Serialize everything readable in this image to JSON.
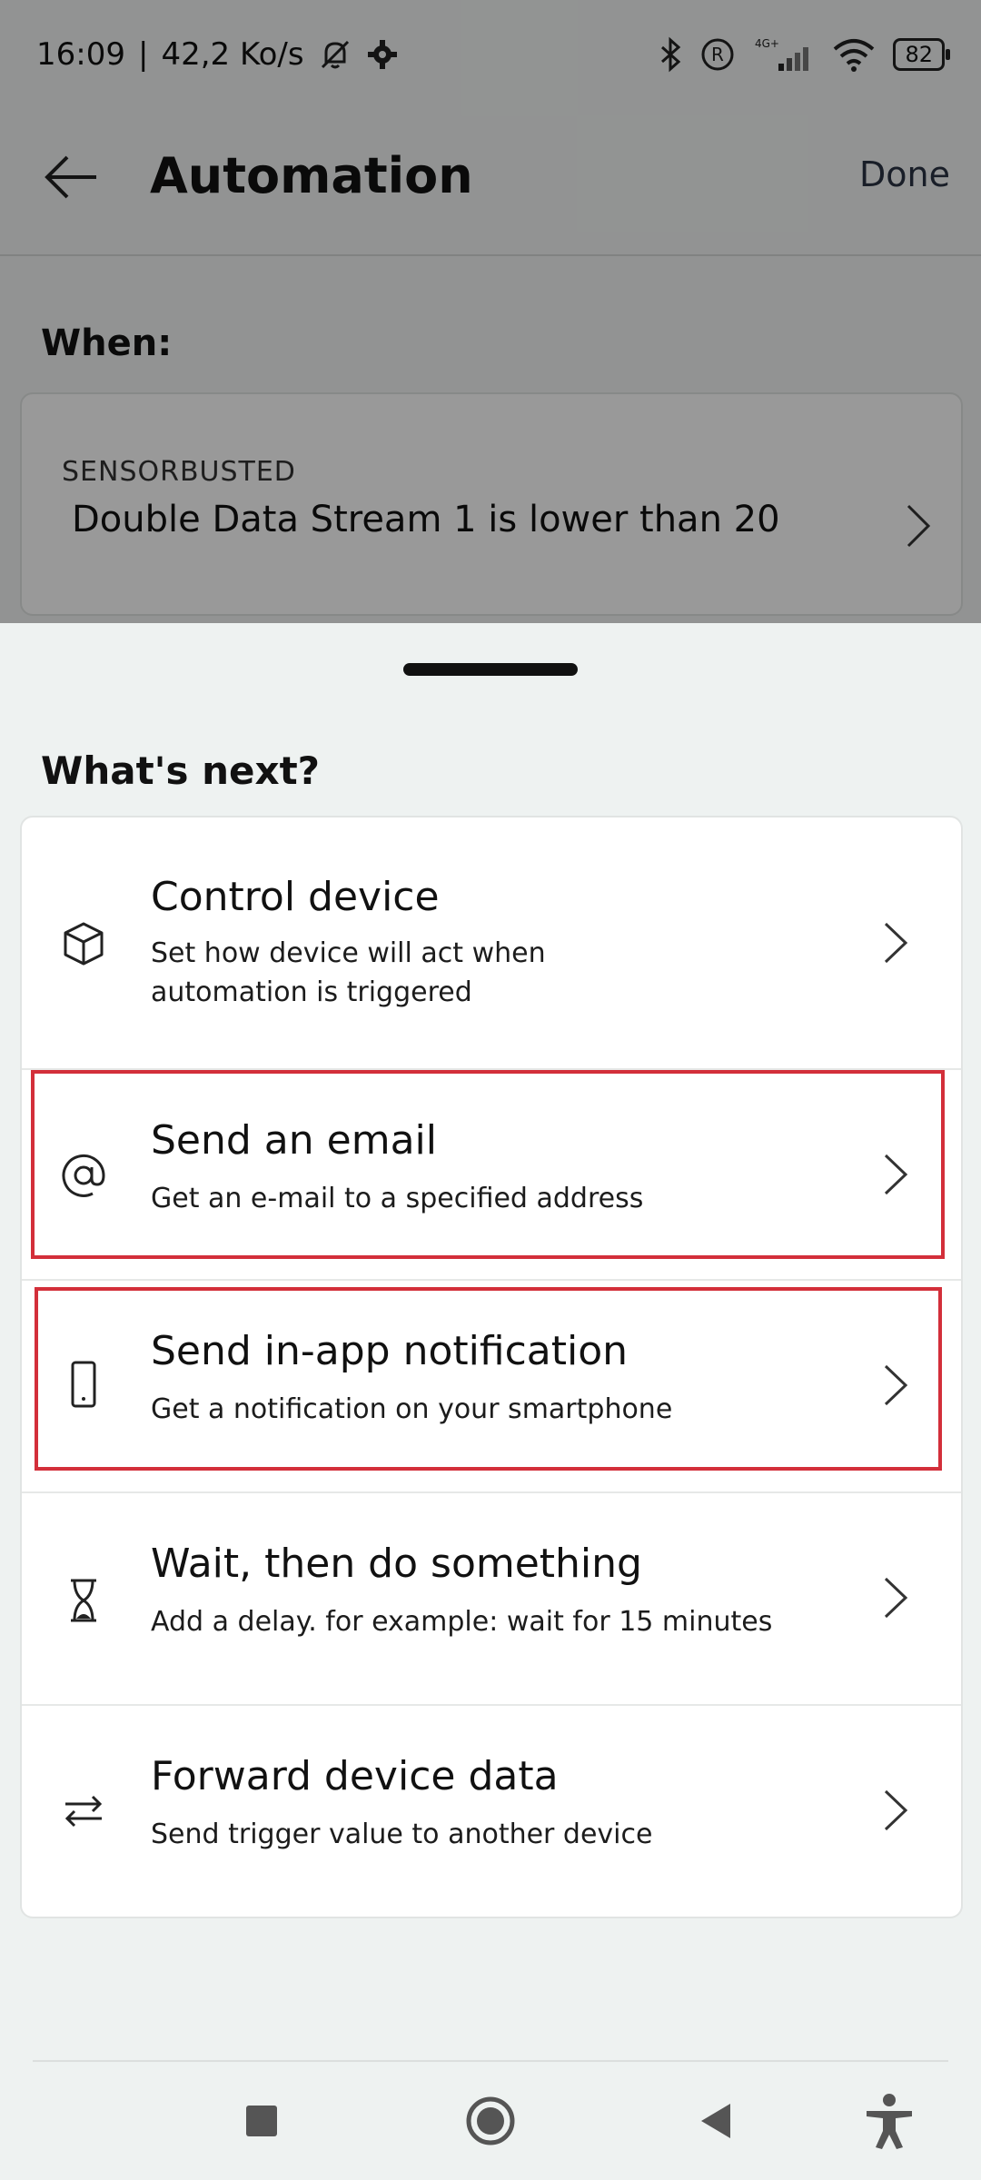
{
  "status_bar": {
    "time": "16:09",
    "separator": "|",
    "speed": "42,2 Ko/s",
    "network": "4G+",
    "battery": "82"
  },
  "app_bar": {
    "title": "Automation",
    "done_label": "Done"
  },
  "when": {
    "label": "When:",
    "sensor": "SENSORBUSTED",
    "condition": "Double Data Stream 1 is lower than 20"
  },
  "sheet": {
    "title": "What's next?",
    "options": [
      {
        "title": "Control device",
        "desc": "Set how device will act when automation is triggered",
        "icon": "cube-icon"
      },
      {
        "title": "Send an email",
        "desc": "Get an e-mail to a specified address",
        "icon": "at-sign-icon"
      },
      {
        "title": "Send in-app notification",
        "desc": "Get a notification on your smartphone",
        "icon": "smartphone-icon"
      },
      {
        "title": "Wait, then do something",
        "desc": "Add a delay. for example: wait for 15 minutes",
        "icon": "hourglass-icon"
      },
      {
        "title": "Forward device data",
        "desc": "Send trigger value to another device",
        "icon": "swap-arrows-icon"
      }
    ]
  },
  "colors": {
    "highlight": "#d32f3a",
    "overlay": "rgba(0,0,0,0.40)",
    "sheet_background": "#eef2f1"
  }
}
